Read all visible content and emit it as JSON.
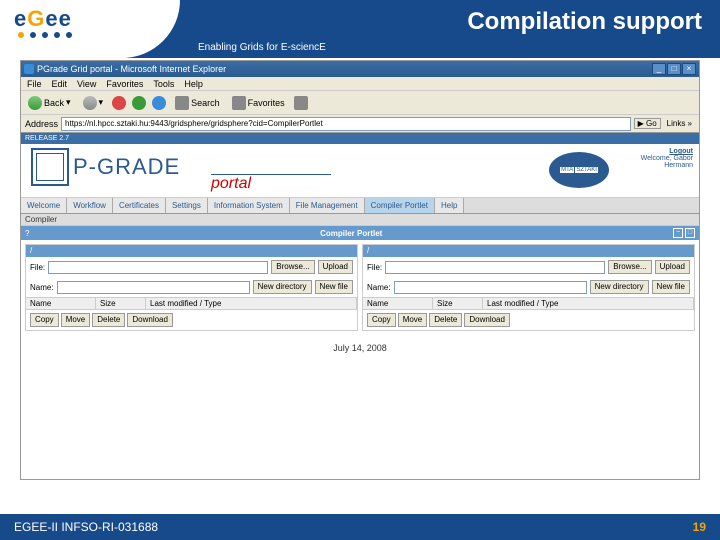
{
  "header": {
    "title": "Compilation support",
    "tagline": "Enabling Grids for E-sciencE",
    "logo_text": "eGee"
  },
  "browser": {
    "window_title": "PGrade Grid portal - Microsoft Internet Explorer",
    "menus": [
      "File",
      "Edit",
      "View",
      "Favorites",
      "Tools",
      "Help"
    ],
    "toolbar": {
      "back": "Back",
      "search": "Search",
      "favorites": "Favorites"
    },
    "address_label": "Address",
    "address_value": "https://nl.hpcc.sztaki.hu:9443/gridsphere/gridsphere?cid=CompilerPortlet",
    "go": "Go",
    "links": "Links",
    "window_buttons": {
      "min": "_",
      "max": "□",
      "close": "×"
    }
  },
  "portal": {
    "release": "RELEASE 2.7",
    "brand": "P-GRADE",
    "sub": "portal",
    "sztaki": {
      "mta": "MTA",
      "sztaki": "SZTAKI"
    },
    "logout": "Logout",
    "welcome": "Welcome, Gabor\nHermann"
  },
  "tabs": [
    "Welcome",
    "Workflow",
    "Certificates",
    "Settings",
    "Information System",
    "File Management",
    "Compiler Portlet",
    "Help"
  ],
  "active_tab": 6,
  "section": "Compiler",
  "portlet": {
    "help": "?",
    "title": "Compiler Portlet",
    "ctrls": [
      "−",
      "□"
    ]
  },
  "panels": {
    "left": {
      "path": "/",
      "file_label": "File:",
      "browse": "Browse...",
      "upload": "Upload",
      "name_label": "Name:",
      "newdir": "New directory",
      "newfile": "New file",
      "headers": {
        "name": "Name",
        "size": "Size",
        "mod": "Last modified / Type"
      },
      "btns": [
        "Copy",
        "Move",
        "Delete",
        "Download"
      ]
    },
    "right": {
      "path": "/",
      "file_label": "File:",
      "browse": "Browse...",
      "upload": "Upload",
      "name_label": "Name:",
      "newdir": "New directory",
      "newfile": "New file",
      "headers": {
        "name": "Name",
        "size": "Size",
        "mod": "Last modified / Type"
      },
      "btns": [
        "Copy",
        "Move",
        "Delete",
        "Download"
      ]
    }
  },
  "date": "July 14, 2008",
  "footer": {
    "left": "EGEE-II INFSO-RI-031688",
    "right": "19"
  }
}
